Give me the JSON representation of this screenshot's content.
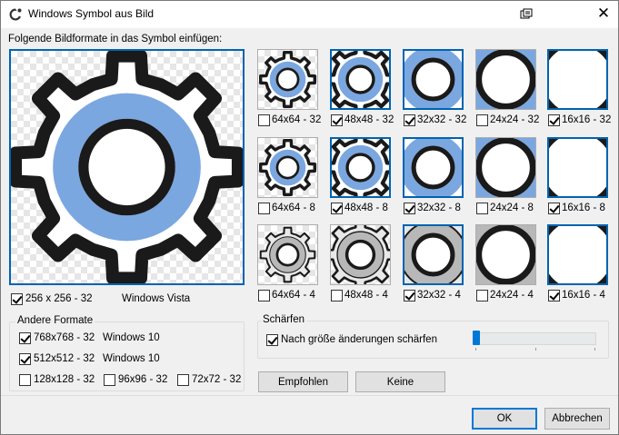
{
  "window": {
    "title": "Windows Symbol aus Bild"
  },
  "main": {
    "instruction": "Folgende Bildformate in das Symbol einfügen:",
    "large_preview": {
      "label": "256 x 256 - 32",
      "os_label": "Windows Vista",
      "checked": true
    }
  },
  "grid": {
    "rows": [
      {
        "items": [
          {
            "label": "64x64 - 32",
            "checked": false
          },
          {
            "label": "48x48 - 32",
            "checked": true
          },
          {
            "label": "32x32 - 32",
            "checked": true
          },
          {
            "label": "24x24 - 32",
            "checked": false
          },
          {
            "label": "16x16 - 32",
            "checked": true
          }
        ]
      },
      {
        "items": [
          {
            "label": "64x64 - 8",
            "checked": false
          },
          {
            "label": "48x48 - 8",
            "checked": true
          },
          {
            "label": "32x32 - 8",
            "checked": true
          },
          {
            "label": "24x24 - 8",
            "checked": false
          },
          {
            "label": "16x16 - 8",
            "checked": true
          }
        ]
      },
      {
        "items": [
          {
            "label": "64x64 - 4",
            "checked": false
          },
          {
            "label": "48x48 - 4",
            "checked": false
          },
          {
            "label": "32x32 - 4",
            "checked": true
          },
          {
            "label": "24x24 - 4",
            "checked": false
          },
          {
            "label": "16x16 - 4",
            "checked": true
          }
        ]
      }
    ]
  },
  "other_formats": {
    "title": "Andere Formate",
    "items": [
      {
        "label": "768x768 - 32",
        "os_label": "Windows 10",
        "checked": true
      },
      {
        "label": "512x512 - 32",
        "os_label": "Windows 10",
        "checked": true
      },
      {
        "label": "128x128 - 32",
        "checked": false
      },
      {
        "label": "96x96 - 32",
        "checked": false
      },
      {
        "label": "72x72 - 32",
        "checked": false
      }
    ]
  },
  "sharpen": {
    "title": "Schärfen",
    "checkbox_label": "Nach größe änderungen schärfen",
    "checked": true,
    "slider_level": 0
  },
  "buttons": {
    "recommended": "Empfohlen",
    "none": "Keine",
    "ok": "OK",
    "cancel": "Abbrechen"
  },
  "colors": {
    "accent": "#0078d7",
    "selection_border": "#0063b1",
    "gear_ring": "#7ba7e0",
    "gear_outline": "#1a1a1a"
  },
  "icons": {
    "app": "gear-app-icon",
    "help": "help-icon",
    "close": "close-icon",
    "preview": "gear-icon"
  }
}
